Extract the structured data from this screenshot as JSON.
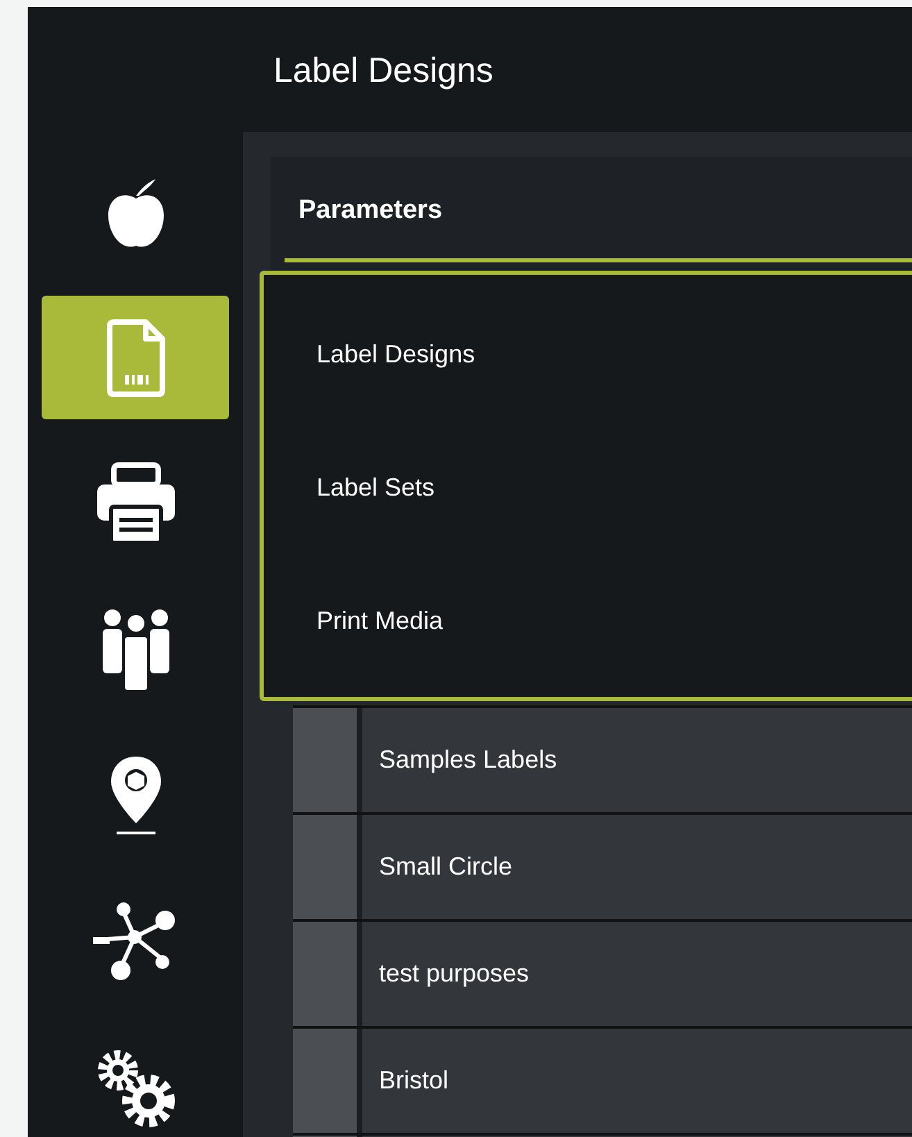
{
  "title": "Label Designs",
  "sidebar": {
    "items": [
      {
        "kind": "apple",
        "selected": false
      },
      {
        "kind": "label",
        "selected": true
      },
      {
        "kind": "printer",
        "selected": false
      },
      {
        "kind": "people",
        "selected": false
      },
      {
        "kind": "location",
        "selected": false
      },
      {
        "kind": "network",
        "selected": false
      },
      {
        "kind": "settings",
        "selected": false
      }
    ]
  },
  "panel": {
    "header": "Parameters"
  },
  "dropdown": {
    "items": [
      "Label Designs",
      "Label Sets",
      "Print Media"
    ]
  },
  "table": {
    "rows": [
      "Samples Labels",
      "Small Circle",
      "test purposes",
      "Bristol"
    ]
  }
}
